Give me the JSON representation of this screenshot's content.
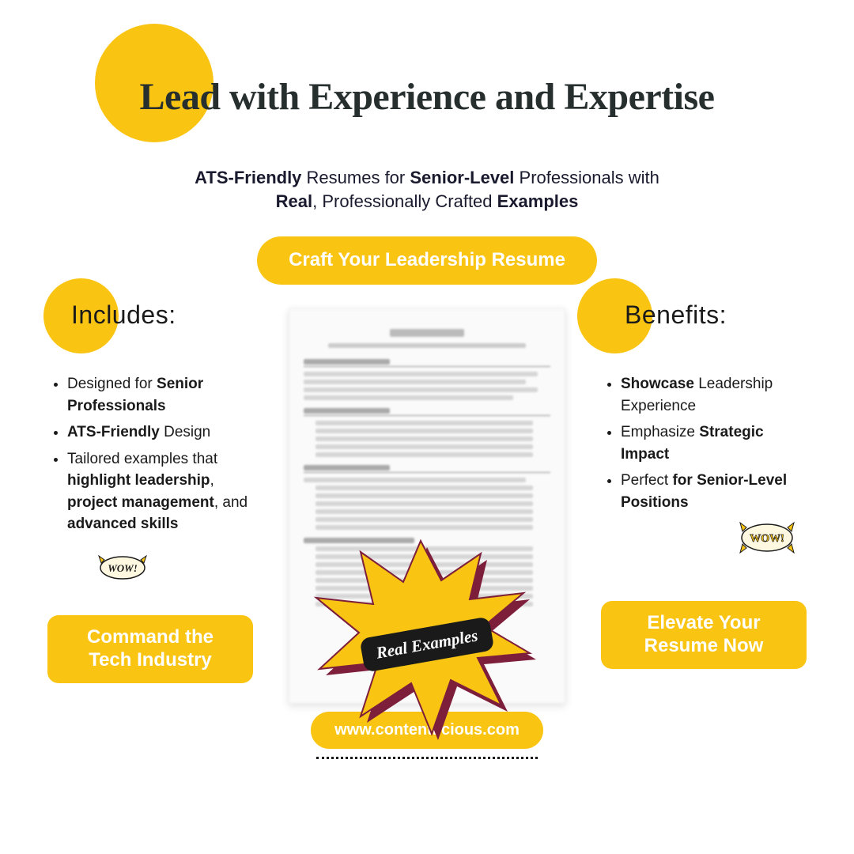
{
  "header": {
    "title": "Lead with Experience and Expertise"
  },
  "subtitle": {
    "html_parts": {
      "p1": "ATS-Friendly",
      "p2": " Resumes for ",
      "p3": "Senior-Level",
      "p4": " Professionals with ",
      "p5": "Real",
      "p6": ", Professionally Crafted ",
      "p7": "Examples"
    }
  },
  "cta_top": "Craft Your Leadership Resume",
  "includes": {
    "label": "Includes:",
    "items": [
      {
        "pre": "Designed for ",
        "bold": "Senior Professionals",
        "post": ""
      },
      {
        "pre": "",
        "bold": "ATS-Friendly",
        "post": " Design"
      },
      {
        "pre": "Tailored examples that ",
        "bold": "highlight leadership",
        "mid": ", ",
        "bold2": "project management",
        "mid2": ", and ",
        "bold3": "advanced skills",
        "post": ""
      }
    ]
  },
  "benefits": {
    "label": "Benefits:",
    "items": [
      {
        "pre": "",
        "bold": "Showcase",
        "post": " Leadership Experience"
      },
      {
        "pre": "Emphasize ",
        "bold": "Strategic Impact",
        "post": ""
      },
      {
        "pre": "Perfect ",
        "bold": "for Senior-Level Positions",
        "post": ""
      }
    ]
  },
  "burst_label": "Real Examples",
  "cta_left": "Command the Tech Industry",
  "cta_right": "Elevate Your Resume Now",
  "footer_url": "www.contentlicious.com",
  "wow_text": "WOW!",
  "colors": {
    "accent": "#f9c412",
    "dark": "#1a1a1a"
  }
}
